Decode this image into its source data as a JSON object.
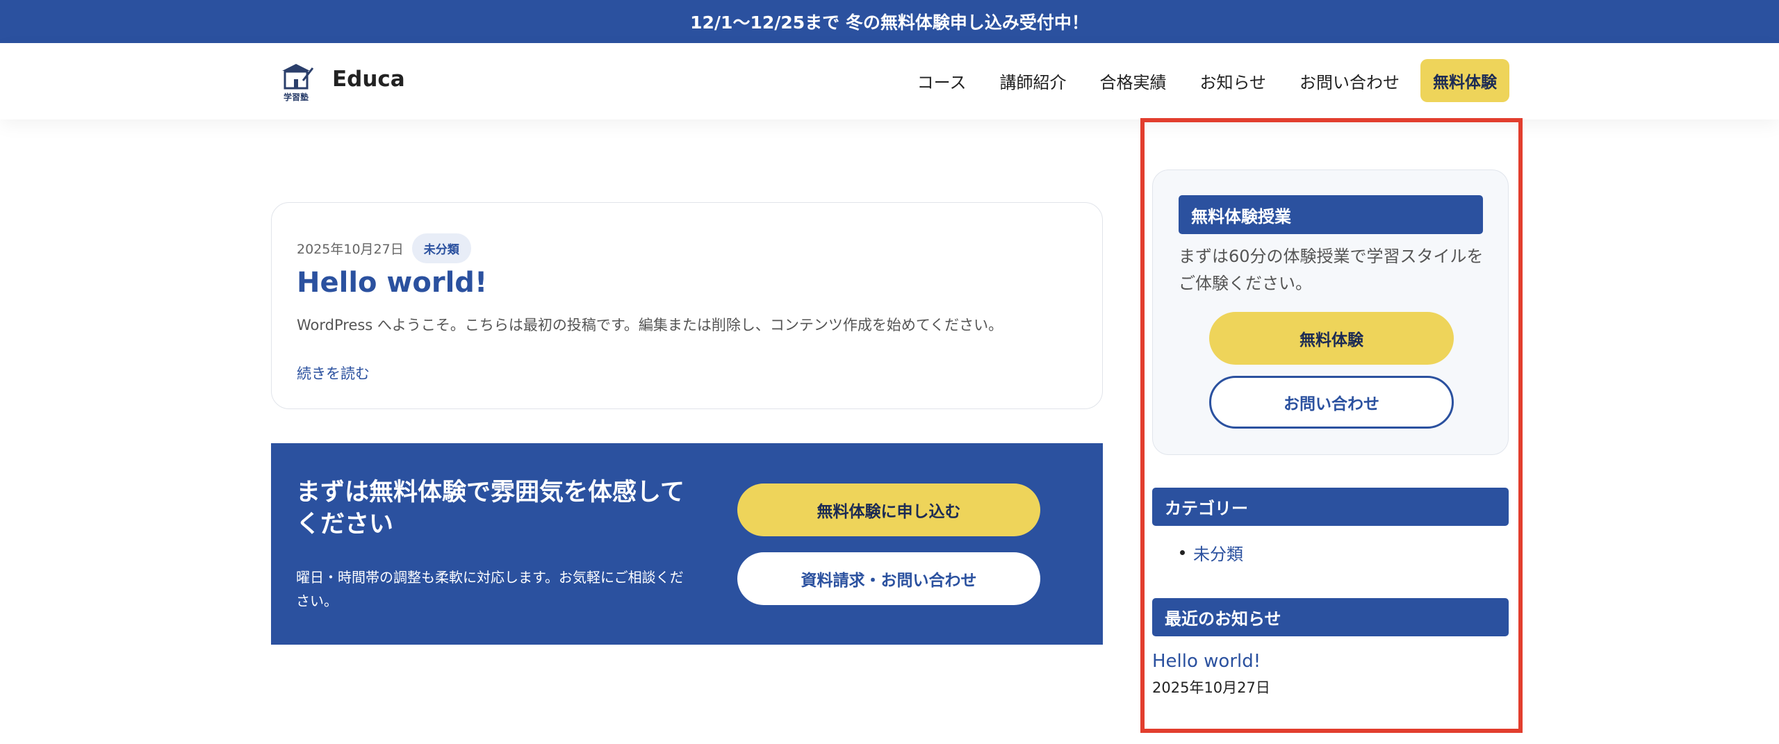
{
  "banner": {
    "text": "12/1〜12/25まで 冬の無料体験申し込み受付中！"
  },
  "header": {
    "logo_caption": "学習塾",
    "site_name": "Educa",
    "nav": [
      {
        "label": "コース"
      },
      {
        "label": "講師紹介"
      },
      {
        "label": "合格実績"
      },
      {
        "label": "お知らせ"
      },
      {
        "label": "お問い合わせ"
      }
    ],
    "cta_label": "無料体験"
  },
  "post": {
    "date": "2025年10月27日",
    "category": "未分類",
    "title": "Hello world!",
    "excerpt": "WordPress へようこそ。こちらは最初の投稿です。編集または削除し、コンテンツ作成を始めてください。",
    "read_more": "続きを読む"
  },
  "cta_band": {
    "title": "まずは無料体験で雰囲気を体感してください",
    "text": "曜日・時間帯の調整も柔軟に対応します。お気軽にご相談ください。",
    "primary_button": "無料体験に申し込む",
    "secondary_button": "資料請求・お問い合わせ"
  },
  "sidebar": {
    "trial": {
      "heading": "無料体験授業",
      "text": "まずは60分の体験授業で学習スタイルをご体験ください。",
      "primary_button": "無料体験",
      "secondary_button": "お問い合わせ"
    },
    "categories": {
      "heading": "カテゴリー",
      "items": [
        {
          "label": "未分類"
        }
      ]
    },
    "news": {
      "heading": "最近のお知らせ",
      "items": [
        {
          "title": "Hello world!",
          "date": "2025年10月27日"
        }
      ]
    }
  },
  "colors": {
    "primary": "#2b519f",
    "accent": "#eed45a",
    "highlight_frame": "#e23e2e"
  }
}
